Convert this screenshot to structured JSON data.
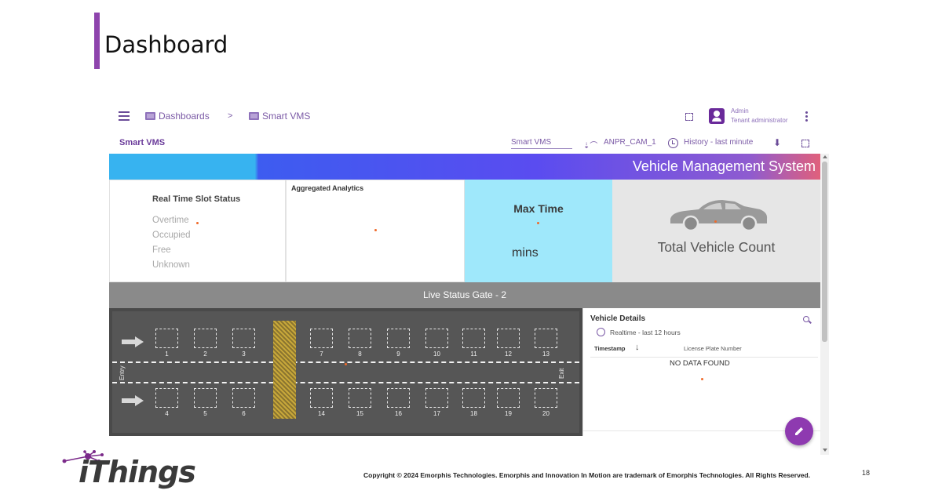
{
  "slide": {
    "title": "Dashboard",
    "logo_text": "iThings",
    "copyright": "Copyright © 2024 Emorphis Technologies. Emorphis and Innovation In Motion are trademark of Emorphis Technologies. All Rights Reserved.",
    "page_number": "18",
    "accent_color": "#8e44ad"
  },
  "header": {
    "breadcrumb": [
      {
        "label": "Dashboards",
        "icon": "dashboard-icon"
      },
      {
        "label": "Smart VMS",
        "icon": "dashboard-icon"
      }
    ],
    "separator": ">",
    "user": {
      "name": "Admin",
      "role": "Tenant administrator"
    }
  },
  "toolbar": {
    "title": "Smart VMS",
    "dashboard_select": "Smart VMS",
    "entity_alias": "ANPR_CAM_1",
    "timewindow": "History - last minute"
  },
  "banner": {
    "title": "Vehicle Management System"
  },
  "widgets": {
    "slot_status": {
      "title": "Real Time Slot Status",
      "legend": [
        "Overtime",
        "Occupied",
        "Free",
        "Unknown"
      ]
    },
    "aggregated": {
      "title": "Aggregated Analytics"
    },
    "max_time": {
      "title": "Max Time",
      "unit": "mins",
      "color": "#9fe8fb"
    },
    "vehicle_count": {
      "title": "Total Vehicle Count"
    }
  },
  "live_status": {
    "title": "Live Status Gate - 2",
    "entry_label": "Entry",
    "exit_label": "Exit",
    "top_row_left": [
      "1",
      "2",
      "3"
    ],
    "top_row_right": [
      "7",
      "8",
      "9",
      "10",
      "11",
      "12",
      "13"
    ],
    "bottom_row_left": [
      "4",
      "5",
      "6"
    ],
    "bottom_row_right": [
      "14",
      "15",
      "16",
      "17",
      "18",
      "19",
      "20"
    ]
  },
  "vehicle_details": {
    "title": "Vehicle Details",
    "timewindow": "Realtime - last 12 hours",
    "columns": [
      "Timestamp",
      "License Plate Number"
    ],
    "empty_text": "NO DATA FOUND"
  }
}
